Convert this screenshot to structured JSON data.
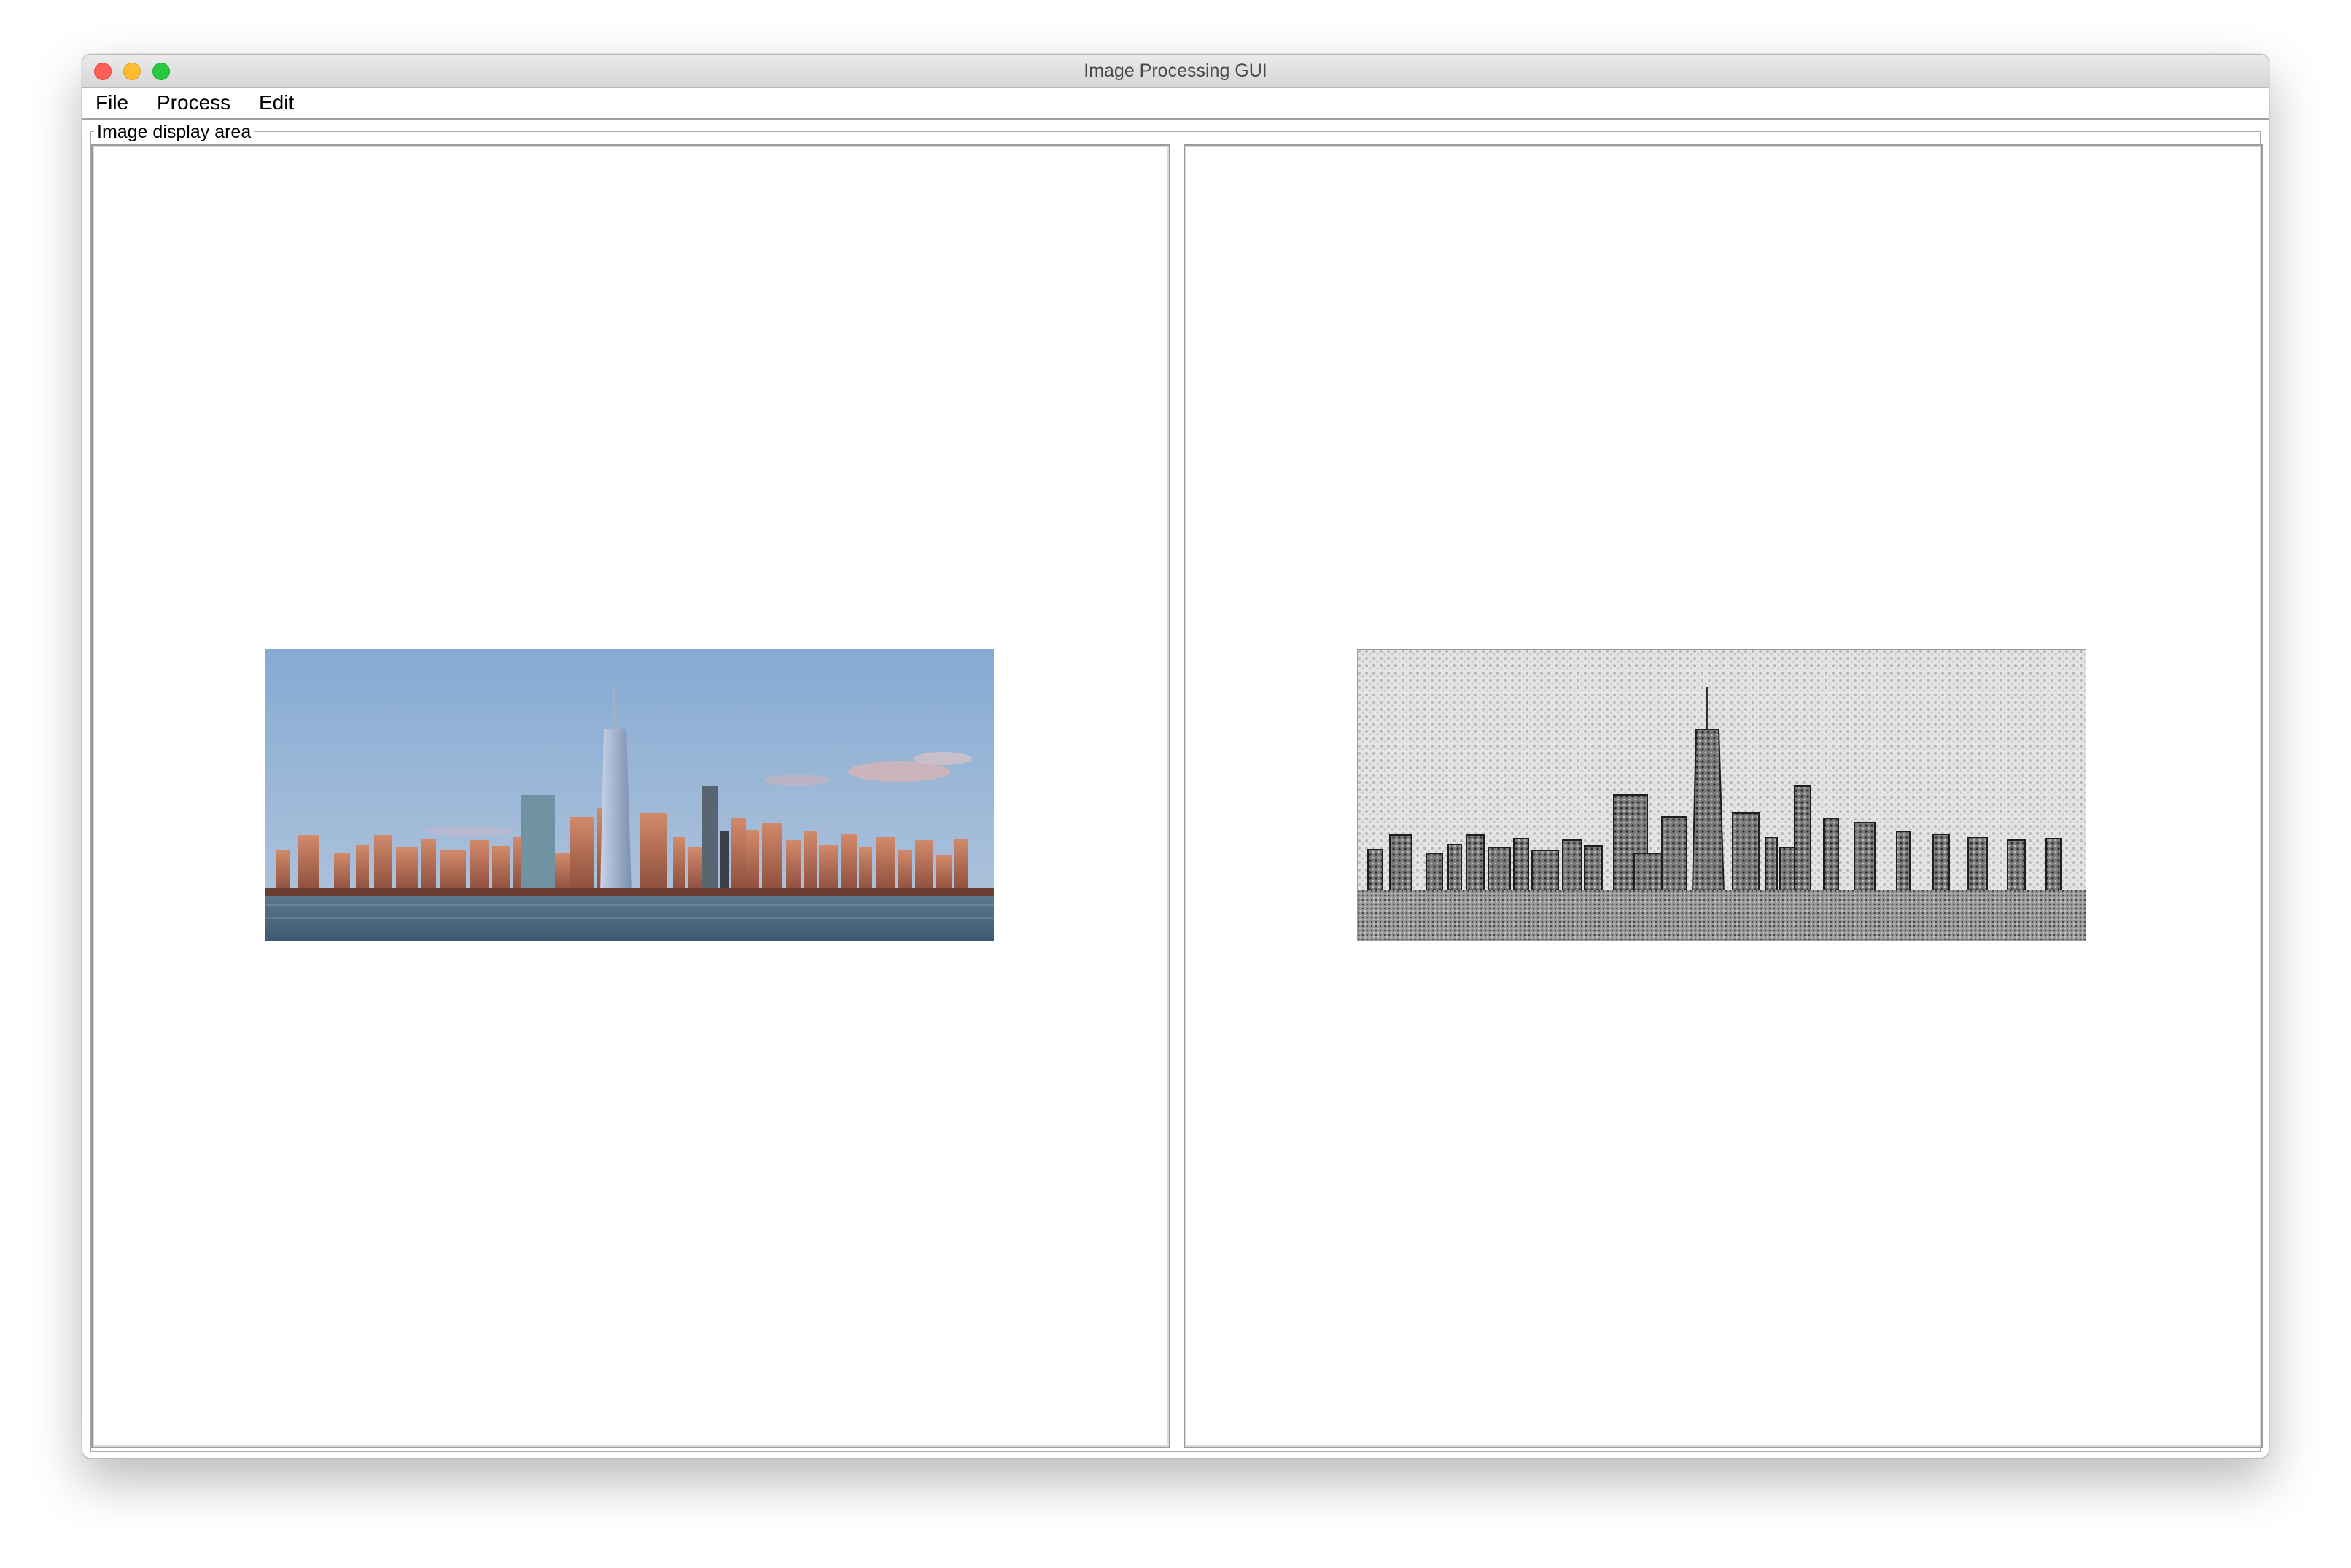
{
  "window": {
    "title": "Image Processing GUI"
  },
  "menu": {
    "file": "File",
    "process": "Process",
    "edit": "Edit"
  },
  "display": {
    "group_label": "Image display area"
  },
  "images": {
    "original": {
      "icon": "skyline-photo-icon"
    },
    "processed": {
      "icon": "skyline-processed-photo-icon"
    }
  },
  "colors": {
    "close": "#fe5f57",
    "minimize": "#febc2e",
    "maximize": "#28c840",
    "sky": "#8fb2d8",
    "water": "#4d6b84",
    "buildings": "#b9705a"
  }
}
